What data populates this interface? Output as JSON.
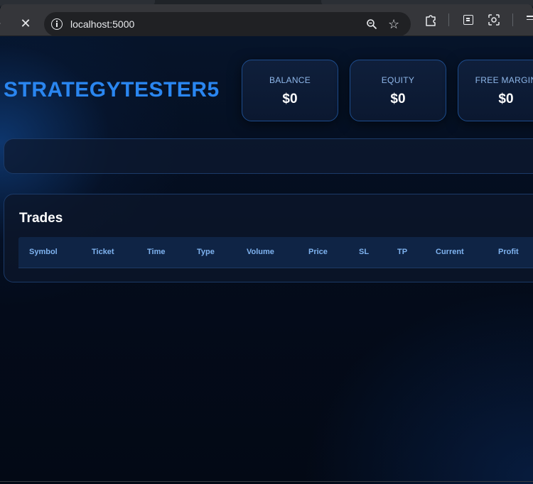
{
  "browser": {
    "url": "localhost:5000",
    "icons": [
      "forward-arrow-icon",
      "stop-loading-icon",
      "site-info-icon",
      "zoom-icon",
      "bookmark-star-icon",
      "extensions-icon",
      "reading-mode-icon",
      "google-lens-icon",
      "menu-icon"
    ]
  },
  "app": {
    "title": "STRATEGYTESTER5",
    "accent_color": "#2a86f0"
  },
  "stats": [
    {
      "label": "BALANCE",
      "value": "$0"
    },
    {
      "label": "EQUITY",
      "value": "$0"
    },
    {
      "label": "FREE MARGIN",
      "value": "$0"
    }
  ],
  "trades": {
    "heading": "Trades",
    "columns": [
      "Symbol",
      "Ticket",
      "Time",
      "Type",
      "Volume",
      "Price",
      "SL",
      "TP",
      "Current",
      "Profit"
    ],
    "rows": []
  }
}
